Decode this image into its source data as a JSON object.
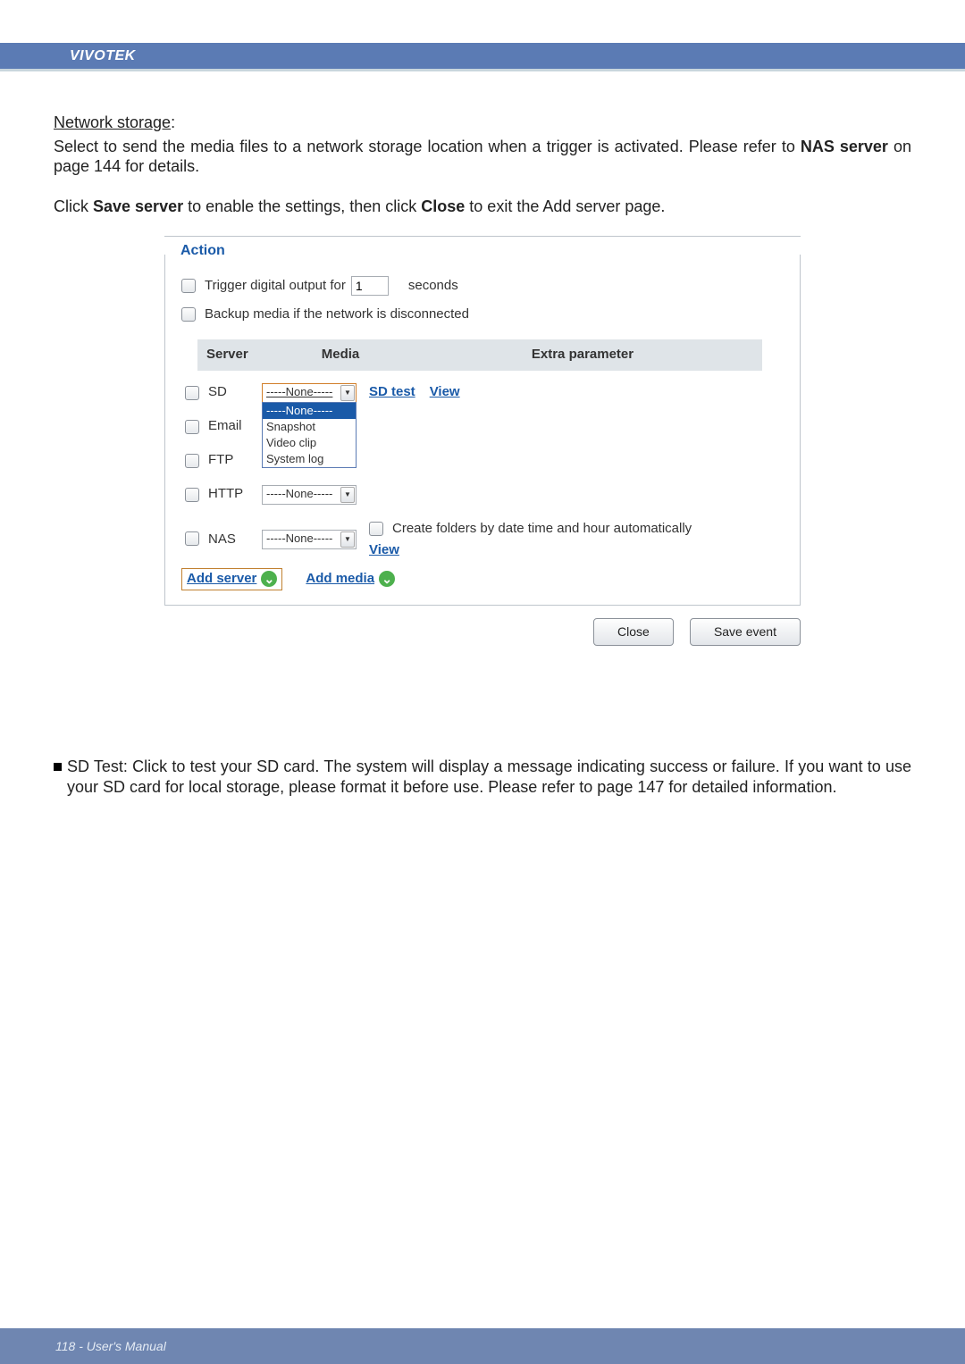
{
  "brand": "VIVOTEK",
  "section_title": "Network storage",
  "section_colon": ":",
  "p1a": "Select to send the media files to a network storage location when a trigger is activated. Please refer to ",
  "p1_bold": "NAS server",
  "p1b": " on page 144 for details.",
  "p2a": "Click ",
  "p2_bold1": "Save server",
  "p2b": " to enable the settings, then click ",
  "p2_bold2": "Close",
  "p2c": " to exit the Add server page.",
  "legend": "Action",
  "trigger_label_a": "Trigger digital output for",
  "trigger_value": "1",
  "trigger_label_b": "seconds",
  "backup_label": "Backup media if the network is disconnected",
  "thead": {
    "server": "Server",
    "media": "Media",
    "extra": "Extra parameter"
  },
  "rows": {
    "sd": "SD",
    "email": "Email",
    "ftp": "FTP",
    "http": "HTTP",
    "nas": "NAS"
  },
  "none_opt": "-----None-----",
  "dd_none": "-----None-----",
  "dd_snapshot": "Snapshot",
  "dd_video": "Video clip",
  "dd_syslog": "System log",
  "sd_test": "SD test",
  "view": "View",
  "nas_create": "Create folders by date time and hour automatically",
  "add_server": "Add server",
  "add_media": "Add media",
  "close_btn": "Close",
  "save_btn": "Save event",
  "bullet_sd": "SD Test: Click to test your SD card. The system will display a message indicating success or failure. If you want to use your SD card for local storage, please format it before use. Please refer to page 147 for detailed information.",
  "footer": "118 - User's Manual"
}
